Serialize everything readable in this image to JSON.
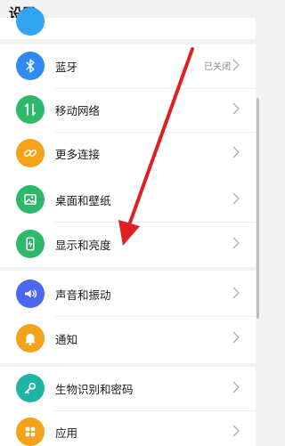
{
  "header": {
    "title": "设置"
  },
  "colors": {
    "top_partial": "#33a3f4",
    "bluetooth": "#2f8bf0",
    "mobile": "#2eb86a",
    "more_conn": "#f5a21b",
    "desktop": "#2eb86a",
    "display": "#2eb86a",
    "sound": "#4a67f0",
    "notify": "#f5a21b",
    "biometric": "#21b4a4",
    "apps": "#f5a21b",
    "annotation_arrow": "#e02020"
  },
  "rows": [
    {
      "label": "蓝牙",
      "value": "已关闭",
      "icon": "bluetooth-icon"
    },
    {
      "label": "移动网络",
      "icon": "mobile-network-icon"
    },
    {
      "label": "更多连接",
      "icon": "link-icon"
    },
    {
      "label": "桌面和壁纸",
      "icon": "image-icon"
    },
    {
      "label": "显示和亮度",
      "icon": "phone-brightness-icon"
    },
    {
      "label": "声音和振动",
      "icon": "speaker-icon"
    },
    {
      "label": "通知",
      "icon": "bell-icon"
    },
    {
      "label": "生物识别和密码",
      "icon": "key-icon"
    },
    {
      "label": "应用",
      "icon": "apps-grid-icon"
    }
  ]
}
